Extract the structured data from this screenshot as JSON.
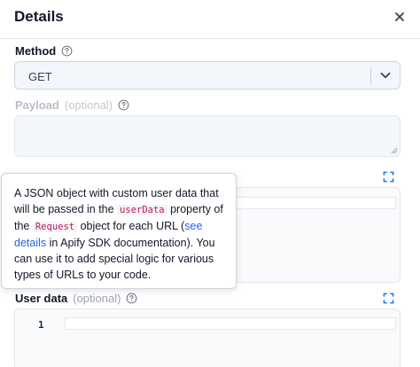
{
  "header": {
    "title": "Details"
  },
  "method": {
    "label": "Method",
    "value": "GET"
  },
  "payload": {
    "label": "Payload",
    "optional": "(optional)"
  },
  "tooltip": {
    "part1": "A JSON object with custom user data that will be passed in the ",
    "code1": "userData",
    "part2": " property of the ",
    "code2": "Request",
    "part3": " object for each URL (",
    "link": "see details",
    "part4": " in Apify SDK documentation). You can use it to add special logic for various types of URLs to your code."
  },
  "user_data": {
    "label": "User data",
    "optional": "(optional)",
    "line_number": "1"
  },
  "colors": {
    "accent": "#1a73e8",
    "code": "#be185d",
    "link": "#2563eb"
  },
  "icons": [
    "close-icon",
    "help-icon",
    "chevron-down-icon",
    "expand-icon",
    "resize-grip-icon"
  ]
}
